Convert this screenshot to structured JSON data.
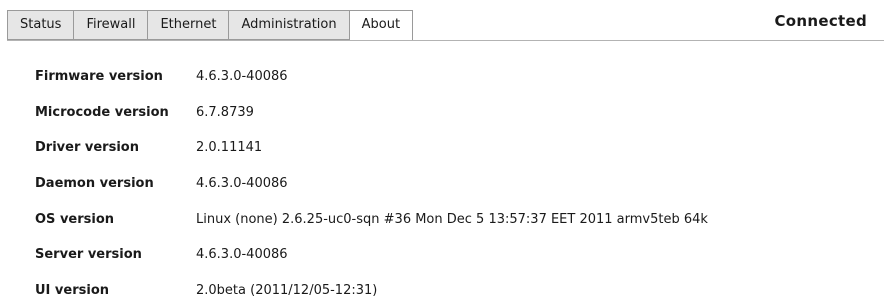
{
  "tabs": [
    {
      "label": "Status"
    },
    {
      "label": "Firewall"
    },
    {
      "label": "Ethernet"
    },
    {
      "label": "Administration"
    },
    {
      "label": "About"
    }
  ],
  "active_tab": "About",
  "connection_status": "Connected",
  "about": {
    "rows": [
      {
        "label": "Firmware version",
        "value": "4.6.3.0-40086"
      },
      {
        "label": "Microcode version",
        "value": "6.7.8739"
      },
      {
        "label": "Driver version",
        "value": "2.0.11141"
      },
      {
        "label": "Daemon version",
        "value": "4.6.3.0-40086"
      },
      {
        "label": "OS version",
        "value": "Linux (none) 2.6.25-uc0-sqn #36 Mon Dec 5 13:57:37 EET 2011 armv5teb 64k"
      },
      {
        "label": "Server version",
        "value": "4.6.3.0-40086"
      },
      {
        "label": "UI version",
        "value": "2.0beta (2011/12/05-12:31)"
      }
    ]
  }
}
